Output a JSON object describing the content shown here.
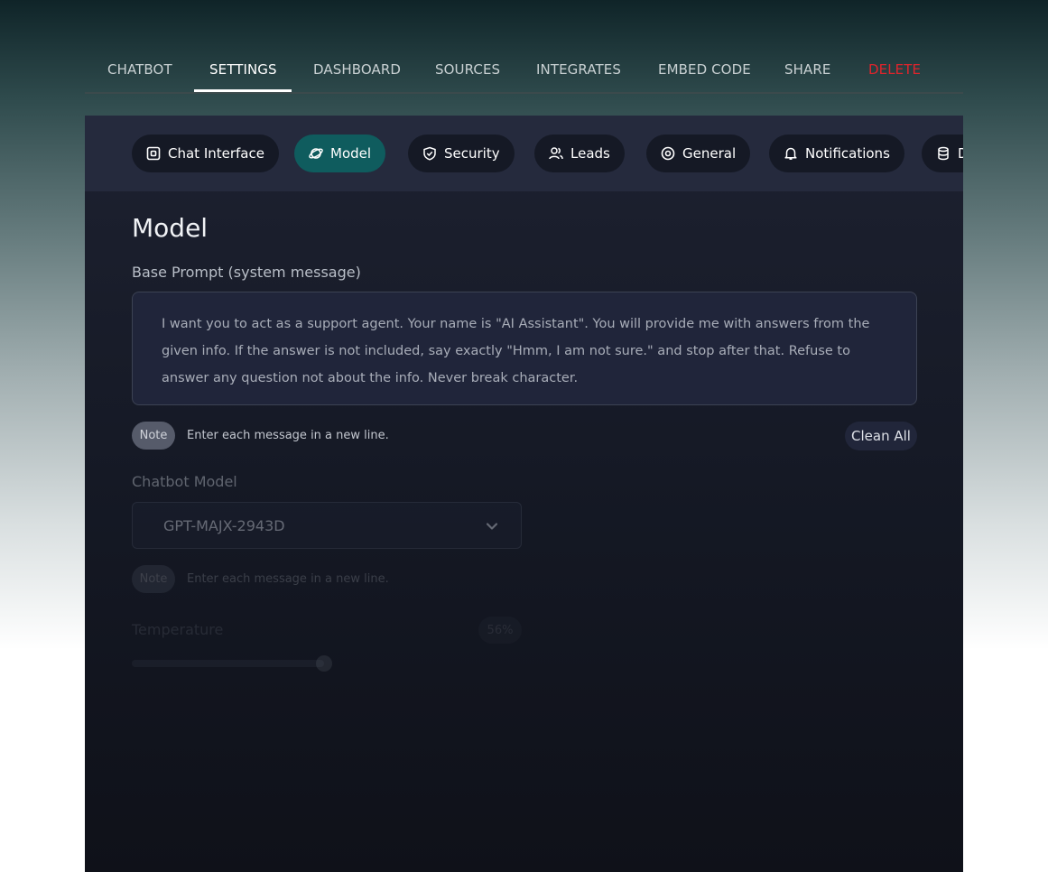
{
  "topnav": {
    "tabs": [
      "CHATBOT",
      "SETTINGS",
      "DASHBOARD",
      "SOURCES",
      "INTEGRATES",
      "EMBED CODE",
      "SHARE",
      "DELETE"
    ],
    "active": "SETTINGS",
    "danger_color": "#e0242c"
  },
  "subtabs": {
    "items": [
      {
        "label": "Chat Interface",
        "icon": "chat-interface-icon"
      },
      {
        "label": "Model",
        "icon": "planet-icon"
      },
      {
        "label": "Security",
        "icon": "shield-icon"
      },
      {
        "label": "Leads",
        "icon": "users-icon"
      },
      {
        "label": "General",
        "icon": "target-icon"
      },
      {
        "label": "Notifications",
        "icon": "bell-icon"
      },
      {
        "label": "D",
        "icon": "database-icon"
      }
    ],
    "active": "Model",
    "active_color": "#0f5c5e"
  },
  "page": {
    "title": "Model",
    "base_prompt_label": "Base Prompt (system message)",
    "base_prompt_value": "I want you to act as a support agent. Your name is \"AI Assistant\". You will provide me with answers from the given info. If the answer is not included, say exactly \"Hmm, I am not sure.\" and stop after that. Refuse to answer any question not about the info. Never break character.",
    "note_badge": "Note",
    "note_text": "Enter each message in a new line.",
    "clean_all": "Clean All",
    "chatbot_model_label": "Chatbot Model",
    "chatbot_model_value": "GPT-MAJX-2943D",
    "note2_badge": "Note",
    "note2_text": "Enter each message in a new line.",
    "temperature_label": "Temperature",
    "temperature_value": "56%",
    "temperature_fraction": 0.56
  }
}
